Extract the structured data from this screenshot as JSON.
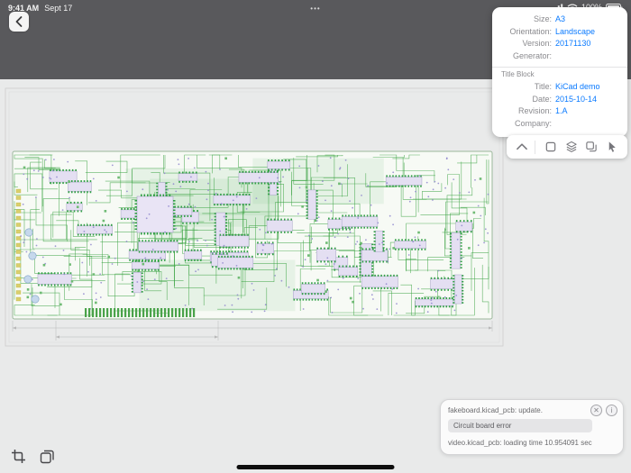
{
  "status_bar": {
    "time": "9:41 AM",
    "date": "Sept 17",
    "menu_dots": "•••",
    "battery_percent": "100%"
  },
  "info_panel": {
    "fields": [
      {
        "label": "Size:",
        "value": "A3"
      },
      {
        "label": "Orientation:",
        "value": "Landscape"
      },
      {
        "label": "Version:",
        "value": "20171130"
      },
      {
        "label": "Generator:",
        "value": ""
      }
    ],
    "section_title": "Title Block",
    "title_fields": [
      {
        "label": "Title:",
        "value": "KiCad demo"
      },
      {
        "label": "Date:",
        "value": "2015-10-14"
      },
      {
        "label": "Revision:",
        "value": "1.A"
      },
      {
        "label": "Company:",
        "value": ""
      }
    ]
  },
  "tool_strip": {
    "icons": [
      "collapse-chevron",
      "frame",
      "layers",
      "copy",
      "select-cursor"
    ]
  },
  "bottom_tools": {
    "icons": [
      "crop-frame",
      "layers-stack"
    ]
  },
  "toast": {
    "line1": "fakeboard.kicad_pcb: update.",
    "pill": "Circuit board error",
    "line3": "video.kicad_pcb: loading time 10.954091 sec",
    "close_glyph": "✕",
    "info_glyph": "i"
  },
  "colors": {
    "header": "#59595c",
    "link_blue": "#0a7aff",
    "trace_green": "#3aa341",
    "via_purple": "#9087ce",
    "canvas_gray": "#e9eaea"
  }
}
